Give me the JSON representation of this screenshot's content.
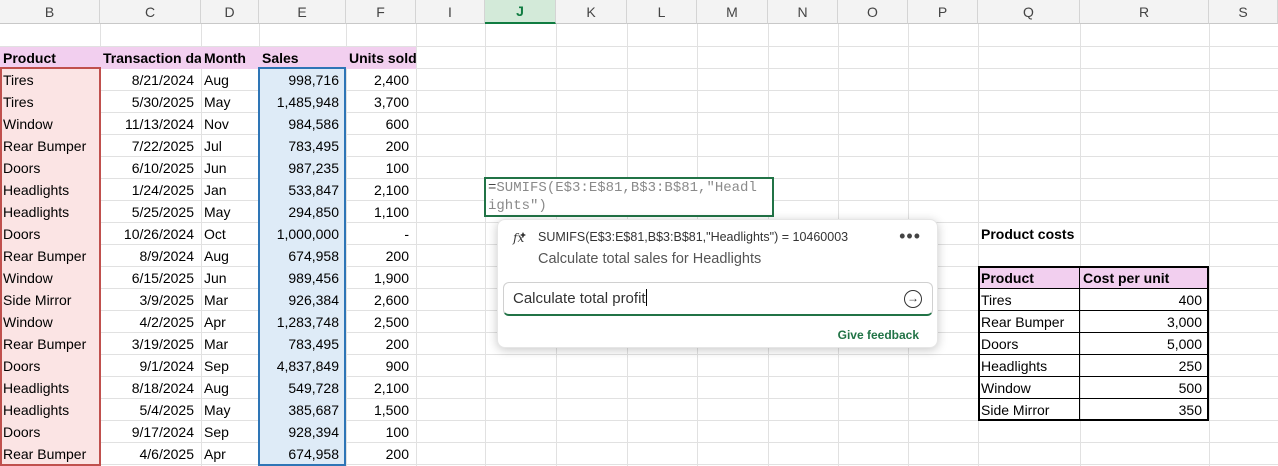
{
  "columns": [
    "B",
    "C",
    "D",
    "E",
    "F",
    "",
    "I",
    "J",
    "K",
    "L",
    "M",
    "N",
    "O",
    "P",
    "Q",
    "R",
    "S"
  ],
  "selected_column": "J",
  "table": {
    "headers": [
      "Product",
      "Transaction dat",
      "Month",
      "Sales",
      "Units sold"
    ],
    "rows": [
      [
        "Tires",
        "8/21/2024",
        "Aug",
        "998,716",
        "2,400"
      ],
      [
        "Tires",
        "5/30/2025",
        "May",
        "1,485,948",
        "3,700"
      ],
      [
        "Window",
        "11/13/2024",
        "Nov",
        "984,586",
        "600"
      ],
      [
        "Rear Bumper",
        "7/22/2025",
        "Jul",
        "783,495",
        "200"
      ],
      [
        "Doors",
        "6/10/2025",
        "Jun",
        "987,235",
        "100"
      ],
      [
        "Headlights",
        "1/24/2025",
        "Jan",
        "533,847",
        "2,100"
      ],
      [
        "Headlights",
        "5/25/2025",
        "May",
        "294,850",
        "1,100"
      ],
      [
        "Doors",
        "10/26/2024",
        "Oct",
        "1,000,000",
        "-"
      ],
      [
        "Rear Bumper",
        "8/9/2024",
        "Aug",
        "674,958",
        "200"
      ],
      [
        "Window",
        "6/15/2025",
        "Jun",
        "989,456",
        "1,900"
      ],
      [
        "Side Mirror",
        "3/9/2025",
        "Mar",
        "926,384",
        "2,600"
      ],
      [
        "Window",
        "4/2/2025",
        "Apr",
        "1,283,748",
        "2,500"
      ],
      [
        "Rear Bumper",
        "3/19/2025",
        "Mar",
        "783,495",
        "200"
      ],
      [
        "Doors",
        "9/1/2024",
        "Sep",
        "4,837,849",
        "900"
      ],
      [
        "Headlights",
        "8/18/2024",
        "Aug",
        "549,728",
        "2,100"
      ],
      [
        "Headlights",
        "5/4/2025",
        "May",
        "385,687",
        "1,500"
      ],
      [
        "Doors",
        "9/17/2024",
        "Sep",
        "928,394",
        "100"
      ],
      [
        "Rear Bumper",
        "4/6/2025",
        "Apr",
        "674,958",
        "200"
      ]
    ]
  },
  "formula_cell": {
    "equals": "=",
    "line1": "SUMIFS(E$3:E$81,B$3:B$81,\"Headl",
    "line2": "ights\")"
  },
  "copilot_popup": {
    "formula_preview": "SUMIFS(E$3:E$81,B$3:B$81,\"Headlights\") = 10460003",
    "description": "Calculate total sales for Headlights",
    "input_value": "Calculate total profit",
    "more_icon": "more-options-icon",
    "send_icon": "send-arrow-icon",
    "feedback_label": "Give feedback"
  },
  "product_costs": {
    "title": "Product costs",
    "headers": [
      "Product",
      "Cost per unit"
    ],
    "rows": [
      [
        "Tires",
        "400"
      ],
      [
        "Rear Bumper",
        "3,000"
      ],
      [
        "Doors",
        "5,000"
      ],
      [
        "Headlights",
        "250"
      ],
      [
        "Window",
        "500"
      ],
      [
        "Side Mirror",
        "350"
      ]
    ]
  },
  "colors": {
    "header_fill": "#f2cfef",
    "product_fill": "#fbe4e4",
    "sales_fill": "#deebf7",
    "accent_green": "#217346"
  }
}
